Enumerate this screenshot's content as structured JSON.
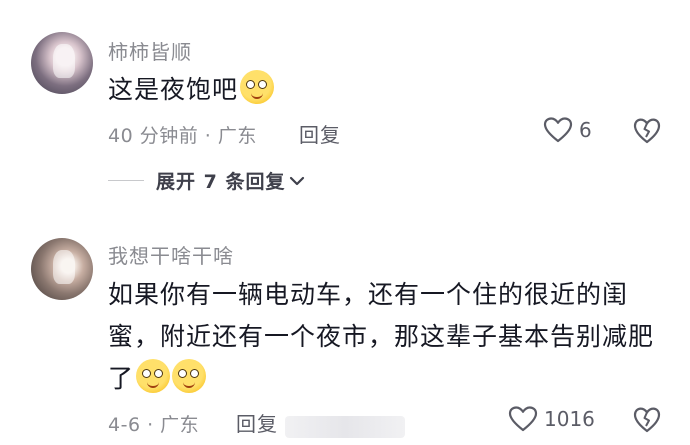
{
  "comments": [
    {
      "username": "柿柿皆顺",
      "text": "这是夜饱吧",
      "emoji_count": 1,
      "time": "40 分钟前 · 广东",
      "reply_label": "回复",
      "likes": "6",
      "expand_label": "展开 7 条回复",
      "icons": {
        "like": "heart-outline-icon",
        "dislike": "broken-heart-icon",
        "expand": "chevron-down-icon"
      }
    },
    {
      "username": "我想干啥干啥",
      "text_lines": [
        "如果你有一辆电动车，还有一个住的很近的闺",
        "蜜，附近还有一个夜市，那这辈子基本告别减肥",
        "了"
      ],
      "emoji_count": 2,
      "time": "4-6 · 广东",
      "reply_label": "回复",
      "likes": "1016",
      "icons": {
        "like": "heart-outline-icon",
        "dislike": "broken-heart-icon"
      }
    }
  ],
  "colors": {
    "text": "#161823",
    "meta": "#8a8b91",
    "action": "#5b5c66"
  }
}
